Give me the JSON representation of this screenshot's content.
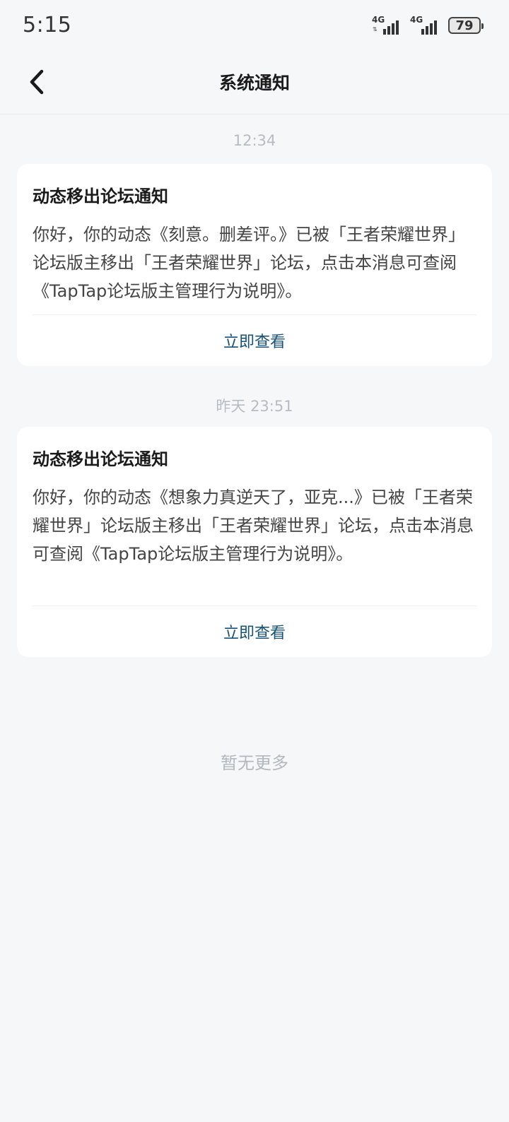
{
  "status_bar": {
    "time": "5:15",
    "network_1": "4G",
    "network_2": "4G",
    "battery": "79"
  },
  "header": {
    "back_icon": "chevron-left-icon",
    "title": "系统通知"
  },
  "notifications": [
    {
      "time": "12:34",
      "title": "动态移出论坛通知",
      "body": "你好，你的动态《刻意。删差评。》已被「王者荣耀世界」论坛版主移出「王者荣耀世界」论坛，点击本消息可查阅《TapTap论坛版主管理行为说明》。",
      "action": "立即查看"
    },
    {
      "time": "昨天  23:51",
      "title": "动态移出论坛通知",
      "body": "你好，你的动态《想象力真逆天了，亚克...》已被「王者荣耀世界」论坛版主移出「王者荣耀世界」论坛，点击本消息可查阅《TapTap论坛版主管理行为说明》。",
      "action": "立即查看"
    }
  ],
  "footer": {
    "no_more": "暂无更多"
  },
  "colors": {
    "background": "#f6f7f9",
    "card": "#ffffff",
    "link": "#15527a",
    "muted": "#b7bcc2"
  }
}
